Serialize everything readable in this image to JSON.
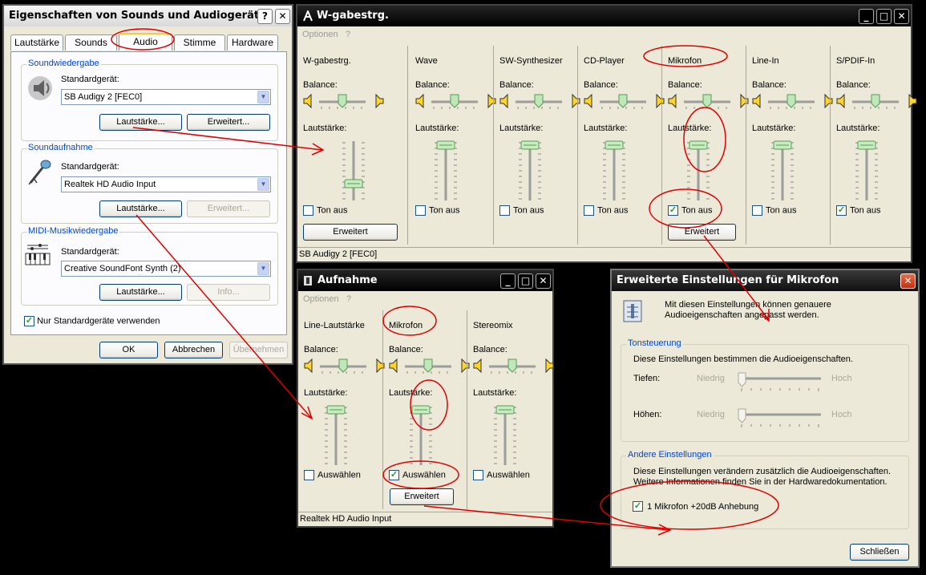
{
  "sound_props": {
    "title": "Eigenschaften von Sounds und Audiogeräte",
    "help_btn": "?",
    "close_btn": "✕",
    "tabs": [
      "Lautstärke",
      "Sounds",
      "Audio",
      "Stimme",
      "Hardware"
    ],
    "playback": {
      "title": "Soundwiedergabe",
      "device_label": "Standardgerät:",
      "device": "SB Audigy 2 [FEC0]",
      "volume_btn": "Lautstärke...",
      "advanced_btn": "Erweitert..."
    },
    "recording": {
      "title": "Soundaufnahme",
      "device_label": "Standardgerät:",
      "device": "Realtek HD Audio Input",
      "volume_btn": "Lautstärke...",
      "advanced_btn": "Erweitert..."
    },
    "midi": {
      "title": "MIDI-Musikwiedergabe",
      "device_label": "Standardgerät:",
      "device": "Creative SoundFont Synth (2)",
      "volume_btn": "Lautstärke...",
      "info_btn": "Info..."
    },
    "only_default": "Nur Standardgeräte verwenden",
    "ok": "OK",
    "cancel": "Abbrechen",
    "apply": "Übernehmen"
  },
  "playback_mixer": {
    "title": "W-gabestrg.",
    "menu": [
      "Optionen",
      "?"
    ],
    "balance_label": "Balance:",
    "volume_label": "Lautstärke:",
    "mute_label": "Ton aus",
    "advanced_btn": "Erweitert",
    "status": "SB Audigy 2 [FEC0]",
    "channels": [
      {
        "name": "W-gabestrg.",
        "muted": false,
        "level": 0.25
      },
      {
        "name": "Wave",
        "muted": false,
        "level": 1.0
      },
      {
        "name": "SW-Synthesizer",
        "muted": false,
        "level": 1.0
      },
      {
        "name": "CD-Player",
        "muted": false,
        "level": 1.0
      },
      {
        "name": "Mikrofon",
        "muted": true,
        "level": 1.0
      },
      {
        "name": "Line-In",
        "muted": false,
        "level": 1.0
      },
      {
        "name": "S/PDIF-In",
        "muted": true,
        "level": 1.0
      }
    ]
  },
  "record_mixer": {
    "title": "Aufnahme",
    "menu": [
      "Optionen",
      "?"
    ],
    "balance_label": "Balance:",
    "volume_label": "Lautstärke:",
    "select_label": "Auswählen",
    "advanced_btn": "Erweitert",
    "status": "Realtek HD Audio Input",
    "channels": [
      {
        "name": "Line-Lautstärke",
        "selected": false,
        "level": 1.0
      },
      {
        "name": "Mikrofon",
        "selected": true,
        "level": 1.0
      },
      {
        "name": "Stereomix",
        "selected": false,
        "level": 1.0
      }
    ]
  },
  "advanced": {
    "title": "Erweiterte Einstellungen für Mikrofon",
    "intro": "Mit diesen Einstellungen können genauere Audioeigenschaften angepasst werden.",
    "tone": {
      "title": "Tonsteuerung",
      "desc": "Diese Einstellungen bestimmen die Audioeigenschaften.",
      "bass": "Tiefen:",
      "treble": "Höhen:",
      "low": "Niedrig",
      "high": "Hoch"
    },
    "other": {
      "title": "Andere Einstellungen",
      "desc1": "Diese Einstellungen verändern zusätzlich die Audioeigenschaften.",
      "desc2": "Weitere Informationen finden Sie in der Hardwaredokumentation.",
      "boost": "1  Mikrofon +20dB Anhebung",
      "boost_checked": true
    },
    "close_btn": "Schließen"
  },
  "annotation_color": "#e00000"
}
